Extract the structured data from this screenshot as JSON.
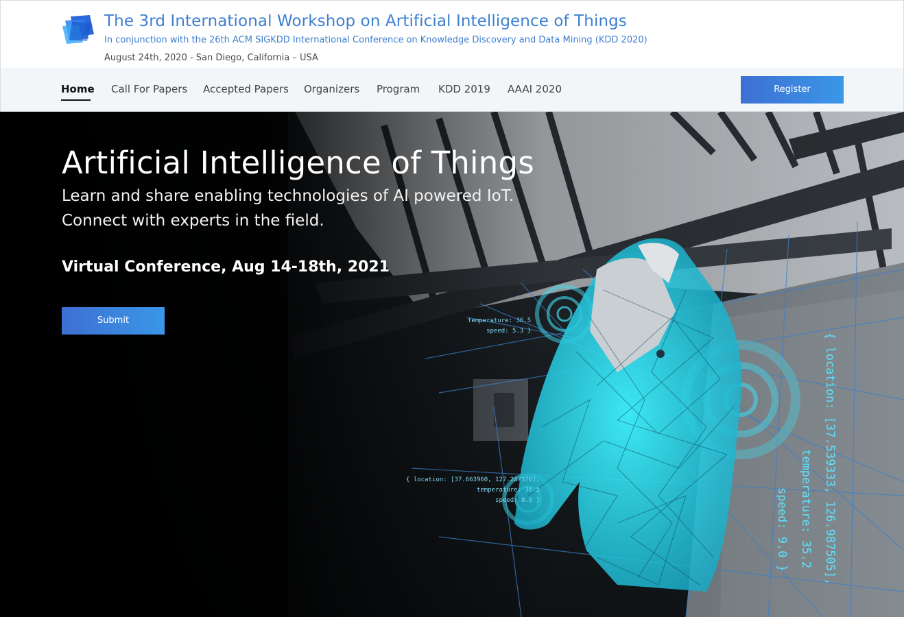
{
  "header": {
    "title": "The 3rd International Workshop on Artificial Intelligence of Things",
    "subtitle": "In conjunction with the 26th ACM SIGKDD International Conference on Knowledge Discovery and Data Mining (KDD 2020)",
    "dateline": "August 24th, 2020 - San Diego, California – USA",
    "logo_icon": "layered-squares-logo",
    "accent_color": "#3d7fd0"
  },
  "nav": {
    "items": [
      {
        "label": "Home",
        "active": true
      },
      {
        "label": "Call For Papers",
        "active": false
      },
      {
        "label": "Accepted Papers",
        "active": false
      },
      {
        "label": "Organizers",
        "active": false
      },
      {
        "label": "Program",
        "active": false
      },
      {
        "label": "KDD 2019",
        "active": false
      },
      {
        "label": "AAAI 2020",
        "active": false
      }
    ],
    "register_label": "Register",
    "button_gradient": [
      "#3e6fd2",
      "#3a97e8"
    ]
  },
  "hero": {
    "title": "Artificial Intelligence of Things",
    "line1": "Learn and share enabling technologies of AI powered IoT.",
    "line2": "Connect with experts in the field.",
    "event": "Virtual Conference, Aug 14-18th, 2021",
    "submit_label": "Submit",
    "overlay_small_top": [
      "temperature: 36.5",
      "speed: 5.3 }"
    ],
    "overlay_small_left": [
      "{ location: [37.663960, 127.247376],",
      "temperature: 36.5",
      "speed: 8.8 }"
    ],
    "overlay_vertical": [
      "{ location: [37.539333, 126.987505],",
      "temperature: 35.2",
      "speed: 9.0 }"
    ],
    "hologram_color": "#2ee6f2"
  }
}
